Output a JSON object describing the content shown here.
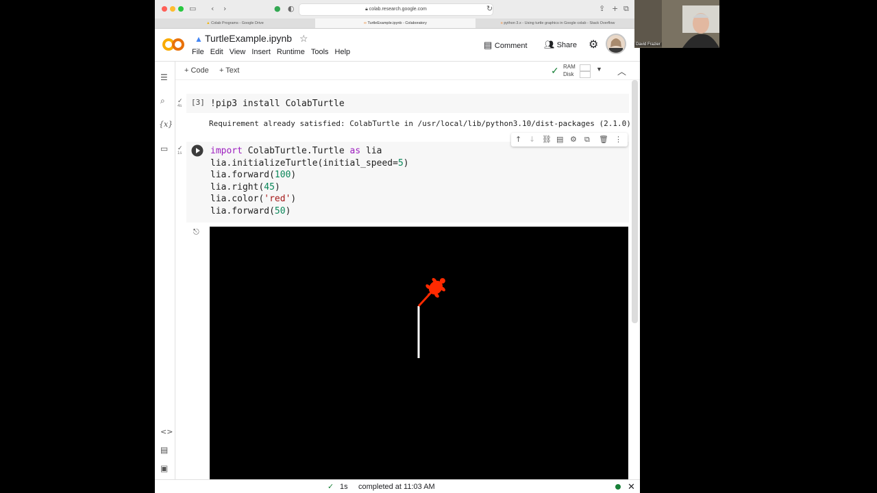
{
  "browser": {
    "url": "colab.research.google.com",
    "tabs": [
      {
        "label": "Colab Programs - Google Drive",
        "active": false
      },
      {
        "label": "TurtleExample.ipynb - Colaboratory",
        "active": true
      },
      {
        "label": "python 3.x - Using turtle graphics in Google colab - Stack Overflow",
        "active": false
      }
    ]
  },
  "header": {
    "logo": "CO",
    "filename": "TurtleExample.ipynb",
    "menu": [
      "File",
      "Edit",
      "View",
      "Insert",
      "Runtime",
      "Tools",
      "Help"
    ],
    "comment_label": "Comment",
    "share_label": "Share"
  },
  "toolbar": {
    "code_label": "+ Code",
    "text_label": "+ Text",
    "ram_label": "RAM",
    "disk_label": "Disk"
  },
  "cells": [
    {
      "exec_count": "[3]",
      "time": "4s",
      "source": "!pip3 install ColabTurtle",
      "output": "Requirement already satisfied: ColabTurtle in /usr/local/lib/python3.10/dist-packages (2.1.0)"
    },
    {
      "time": "1s",
      "lines": [
        "import ColabTurtle.Turtle as lia",
        "lia.initializeTurtle(initial_speed=5)",
        "lia.forward(100)",
        "lia.right(45)",
        "lia.color('red')",
        "lia.forward(50)"
      ]
    }
  ],
  "status": {
    "duration": "1s",
    "message": "completed at 11:03 AM"
  },
  "webcam": {
    "name": "David Frazier"
  },
  "colors": {
    "accent": "#f9ab00",
    "logo_orange": "#e8710a",
    "keyword": "#9c1ebf",
    "number": "#098658",
    "string": "#a31515",
    "turtle": "#ff2a00",
    "ok_green": "#188038"
  }
}
